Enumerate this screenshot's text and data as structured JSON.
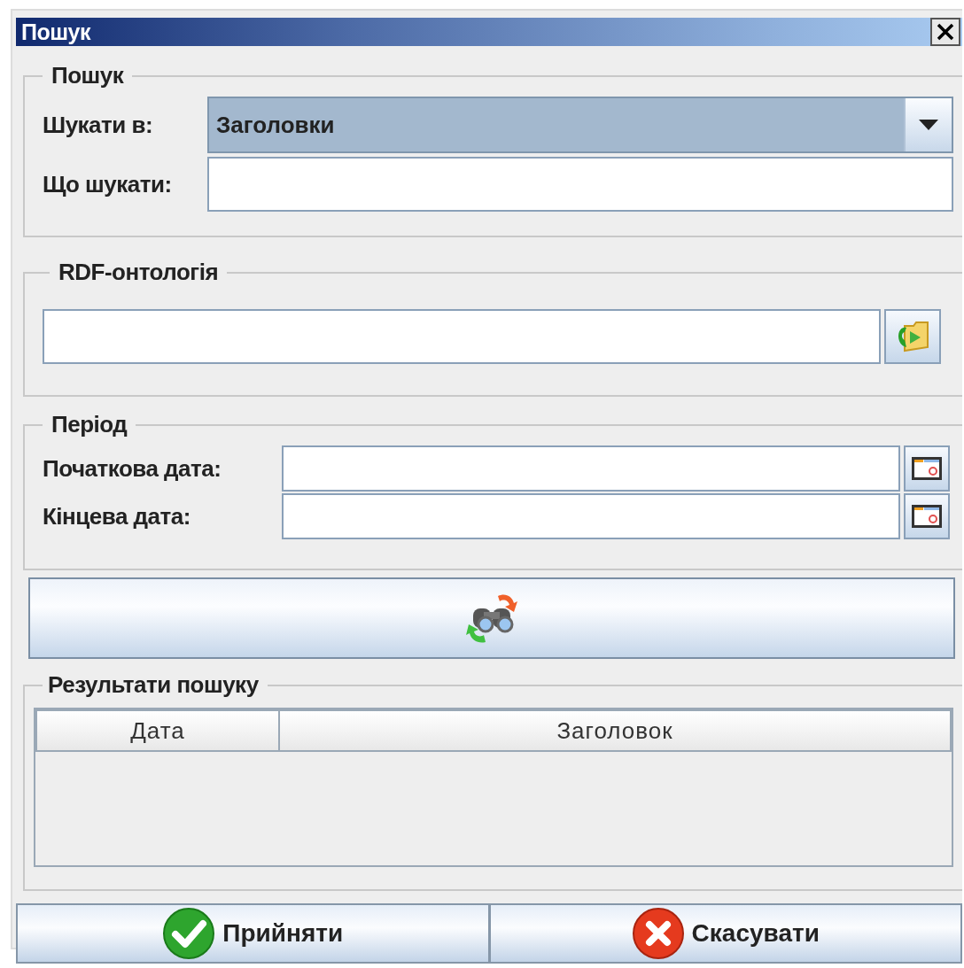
{
  "window": {
    "title": "Пошук"
  },
  "search_group": {
    "title": "Пошук",
    "search_in": {
      "label": "Шукати в:",
      "value": "Заголовки"
    },
    "query": {
      "label": "Що шукати:"
    }
  },
  "ontology_group": {
    "title": "RDF-онтологія"
  },
  "period_group": {
    "title": "Період",
    "start_date": {
      "label": "Початкова дата:"
    },
    "end_date": {
      "label": "Кінцева дата:"
    }
  },
  "results_group": {
    "title": "Результати пошуку",
    "table": {
      "columns": [
        "Дата",
        "Заголовок"
      ]
    }
  },
  "buttons": [
    {
      "kind": "accept",
      "label": "Прийняти"
    },
    {
      "kind": "cancel",
      "label": "Скасувати"
    }
  ]
}
